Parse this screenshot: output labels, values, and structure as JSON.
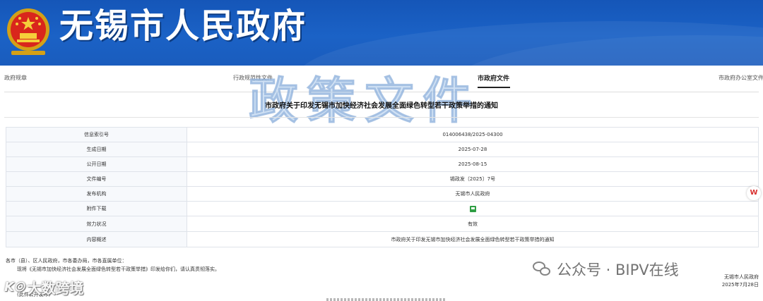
{
  "header": {
    "site_title": "无锡市人民政府",
    "brand_color": "#1a5cbd"
  },
  "nav": {
    "items": [
      {
        "label": "政府规章"
      },
      {
        "label": "行政规范性文件"
      },
      {
        "label": "市政府文件",
        "active": true
      },
      {
        "label": "市政府办公室文件"
      }
    ]
  },
  "watermark": {
    "policy_text": "政策文件"
  },
  "document": {
    "title": "市政府关于印发无锡市加快经济社会发展全面绿色转型若干政策举措的通知",
    "info": [
      {
        "label": "信息索引号",
        "value": "014006438/2025-04300"
      },
      {
        "label": "生成日期",
        "value": "2025-07-28"
      },
      {
        "label": "公开日期",
        "value": "2025-08-15"
      },
      {
        "label": "文件编号",
        "value": "锡政发〔2025〕7号"
      },
      {
        "label": "发布机构",
        "value": "无锡市人民政府"
      },
      {
        "label": "附件下载",
        "value": ""
      },
      {
        "label": "效力状况",
        "value": "有效"
      },
      {
        "label": "内容概述",
        "value": "市政府关于印发无锡市加快经济社会发展全面绿色转型若干政策举措的通知"
      }
    ],
    "recipients": "各市（县）、区人民政府，市各委办局，市各直属单位：",
    "body_line": "现将《无锡市加快经济社会发展全面绿色转型若干政策举措》印发给你们，请认真贯彻落实。",
    "note": "(此件公开发布)",
    "signature": "无锡市人民政府",
    "sign_date": "2025年7月28日"
  },
  "overlays": {
    "wechat_label": "公众号 · BIPV在线",
    "bigdata_label": "大数跨境",
    "bigdata_prefix": "K⦾"
  },
  "side_badge": "W"
}
